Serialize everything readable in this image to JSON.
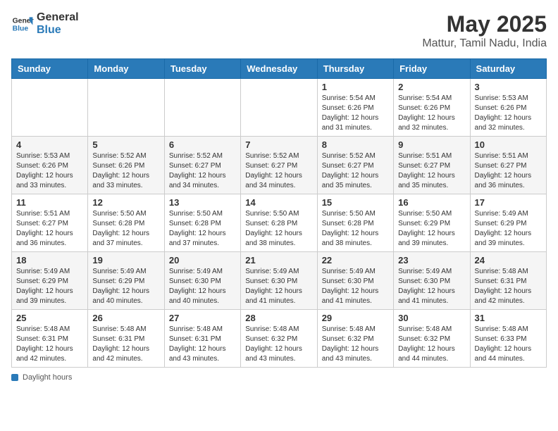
{
  "logo": {
    "line1": "General",
    "line2": "Blue"
  },
  "title": "May 2025",
  "subtitle": "Mattur, Tamil Nadu, India",
  "days_of_week": [
    "Sunday",
    "Monday",
    "Tuesday",
    "Wednesday",
    "Thursday",
    "Friday",
    "Saturday"
  ],
  "footer_label": "Daylight hours",
  "weeks": [
    {
      "days": [
        {
          "num": "",
          "info": ""
        },
        {
          "num": "",
          "info": ""
        },
        {
          "num": "",
          "info": ""
        },
        {
          "num": "",
          "info": ""
        },
        {
          "num": "1",
          "info": "Sunrise: 5:54 AM\nSunset: 6:26 PM\nDaylight: 12 hours\nand 31 minutes."
        },
        {
          "num": "2",
          "info": "Sunrise: 5:54 AM\nSunset: 6:26 PM\nDaylight: 12 hours\nand 32 minutes."
        },
        {
          "num": "3",
          "info": "Sunrise: 5:53 AM\nSunset: 6:26 PM\nDaylight: 12 hours\nand 32 minutes."
        }
      ]
    },
    {
      "days": [
        {
          "num": "4",
          "info": "Sunrise: 5:53 AM\nSunset: 6:26 PM\nDaylight: 12 hours\nand 33 minutes."
        },
        {
          "num": "5",
          "info": "Sunrise: 5:52 AM\nSunset: 6:26 PM\nDaylight: 12 hours\nand 33 minutes."
        },
        {
          "num": "6",
          "info": "Sunrise: 5:52 AM\nSunset: 6:27 PM\nDaylight: 12 hours\nand 34 minutes."
        },
        {
          "num": "7",
          "info": "Sunrise: 5:52 AM\nSunset: 6:27 PM\nDaylight: 12 hours\nand 34 minutes."
        },
        {
          "num": "8",
          "info": "Sunrise: 5:52 AM\nSunset: 6:27 PM\nDaylight: 12 hours\nand 35 minutes."
        },
        {
          "num": "9",
          "info": "Sunrise: 5:51 AM\nSunset: 6:27 PM\nDaylight: 12 hours\nand 35 minutes."
        },
        {
          "num": "10",
          "info": "Sunrise: 5:51 AM\nSunset: 6:27 PM\nDaylight: 12 hours\nand 36 minutes."
        }
      ]
    },
    {
      "days": [
        {
          "num": "11",
          "info": "Sunrise: 5:51 AM\nSunset: 6:27 PM\nDaylight: 12 hours\nand 36 minutes."
        },
        {
          "num": "12",
          "info": "Sunrise: 5:50 AM\nSunset: 6:28 PM\nDaylight: 12 hours\nand 37 minutes."
        },
        {
          "num": "13",
          "info": "Sunrise: 5:50 AM\nSunset: 6:28 PM\nDaylight: 12 hours\nand 37 minutes."
        },
        {
          "num": "14",
          "info": "Sunrise: 5:50 AM\nSunset: 6:28 PM\nDaylight: 12 hours\nand 38 minutes."
        },
        {
          "num": "15",
          "info": "Sunrise: 5:50 AM\nSunset: 6:28 PM\nDaylight: 12 hours\nand 38 minutes."
        },
        {
          "num": "16",
          "info": "Sunrise: 5:50 AM\nSunset: 6:29 PM\nDaylight: 12 hours\nand 39 minutes."
        },
        {
          "num": "17",
          "info": "Sunrise: 5:49 AM\nSunset: 6:29 PM\nDaylight: 12 hours\nand 39 minutes."
        }
      ]
    },
    {
      "days": [
        {
          "num": "18",
          "info": "Sunrise: 5:49 AM\nSunset: 6:29 PM\nDaylight: 12 hours\nand 39 minutes."
        },
        {
          "num": "19",
          "info": "Sunrise: 5:49 AM\nSunset: 6:29 PM\nDaylight: 12 hours\nand 40 minutes."
        },
        {
          "num": "20",
          "info": "Sunrise: 5:49 AM\nSunset: 6:30 PM\nDaylight: 12 hours\nand 40 minutes."
        },
        {
          "num": "21",
          "info": "Sunrise: 5:49 AM\nSunset: 6:30 PM\nDaylight: 12 hours\nand 41 minutes."
        },
        {
          "num": "22",
          "info": "Sunrise: 5:49 AM\nSunset: 6:30 PM\nDaylight: 12 hours\nand 41 minutes."
        },
        {
          "num": "23",
          "info": "Sunrise: 5:49 AM\nSunset: 6:30 PM\nDaylight: 12 hours\nand 41 minutes."
        },
        {
          "num": "24",
          "info": "Sunrise: 5:48 AM\nSunset: 6:31 PM\nDaylight: 12 hours\nand 42 minutes."
        }
      ]
    },
    {
      "days": [
        {
          "num": "25",
          "info": "Sunrise: 5:48 AM\nSunset: 6:31 PM\nDaylight: 12 hours\nand 42 minutes."
        },
        {
          "num": "26",
          "info": "Sunrise: 5:48 AM\nSunset: 6:31 PM\nDaylight: 12 hours\nand 42 minutes."
        },
        {
          "num": "27",
          "info": "Sunrise: 5:48 AM\nSunset: 6:31 PM\nDaylight: 12 hours\nand 43 minutes."
        },
        {
          "num": "28",
          "info": "Sunrise: 5:48 AM\nSunset: 6:32 PM\nDaylight: 12 hours\nand 43 minutes."
        },
        {
          "num": "29",
          "info": "Sunrise: 5:48 AM\nSunset: 6:32 PM\nDaylight: 12 hours\nand 43 minutes."
        },
        {
          "num": "30",
          "info": "Sunrise: 5:48 AM\nSunset: 6:32 PM\nDaylight: 12 hours\nand 44 minutes."
        },
        {
          "num": "31",
          "info": "Sunrise: 5:48 AM\nSunset: 6:33 PM\nDaylight: 12 hours\nand 44 minutes."
        }
      ]
    }
  ]
}
